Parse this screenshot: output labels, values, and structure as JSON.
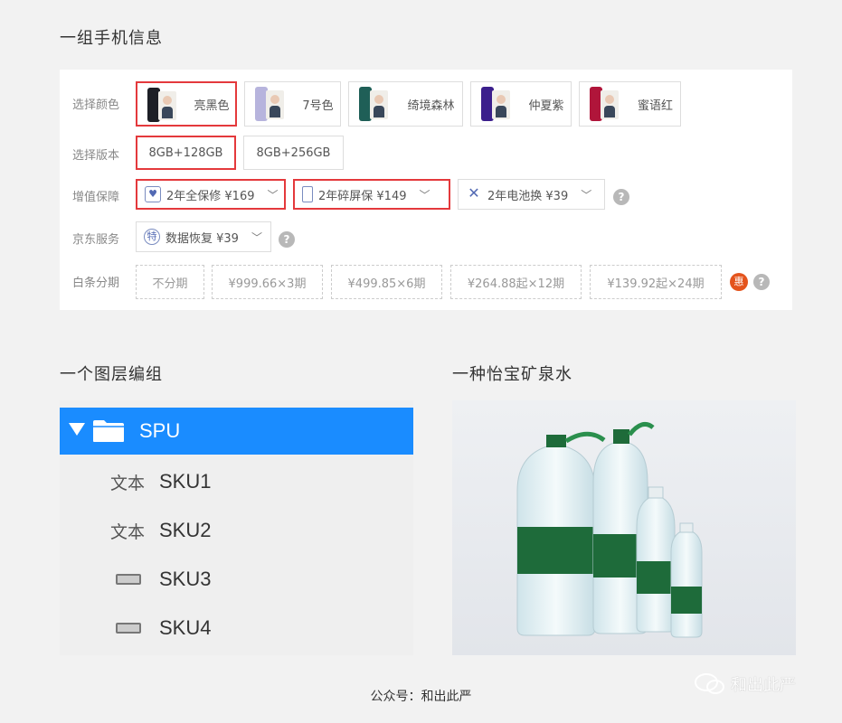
{
  "sections": {
    "phone_title": "一组手机信息",
    "layer_title": "一个图层编组",
    "water_title": "一种怡宝矿泉水"
  },
  "product": {
    "labels": {
      "color": "选择颜色",
      "version": "选择版本",
      "value_added": "增值保障",
      "jd_service": "京东服务",
      "installment": "白条分期"
    },
    "colors": [
      {
        "label": "亮黑色",
        "selected": true,
        "swatch": "#1d1f26"
      },
      {
        "label": "7号色",
        "selected": false,
        "swatch": "#b7b4dd"
      },
      {
        "label": "绮境森林",
        "selected": false,
        "swatch": "#1f5f57"
      },
      {
        "label": "仲夏紫",
        "selected": false,
        "swatch": "#3b1f8c"
      },
      {
        "label": "蜜语红",
        "selected": false,
        "swatch": "#b0153a"
      }
    ],
    "versions": [
      {
        "label": "8GB+128GB",
        "selected": true
      },
      {
        "label": "8GB+256GB",
        "selected": false
      }
    ],
    "services": [
      {
        "label": "2年全保修 ¥169",
        "icon": "shield-heart-icon",
        "selected": true
      },
      {
        "label": "2年碎屏保 ¥149",
        "icon": "phone-screen-icon",
        "selected": true
      },
      {
        "label": "2年电池换 ¥39",
        "icon": "tools-icon",
        "selected": false
      }
    ],
    "jd_service": {
      "label": "数据恢复 ¥39",
      "icon_char": "特"
    },
    "installments": [
      "不分期",
      "¥999.66×3期",
      "¥499.85×6期",
      "¥264.88起×12期",
      "¥139.92起×24期"
    ],
    "hui_badge": "惠",
    "help_glyph": "?",
    "chevron_glyph": "﹀"
  },
  "layers": {
    "group": {
      "label": "SPU",
      "selected": true
    },
    "items": [
      {
        "label": "SKU1",
        "icon": "text",
        "icon_text": "文本"
      },
      {
        "label": "SKU2",
        "icon": "text",
        "icon_text": "文本"
      },
      {
        "label": "SKU3",
        "icon": "rectangle"
      },
      {
        "label": "SKU4",
        "icon": "rectangle"
      }
    ]
  },
  "footer": "公众号：和出此严",
  "watermark": "和出此严",
  "colors": {
    "accent_red": "#e4393c",
    "selection_blue": "#1a8cff",
    "bottle_green": "#1e6b3a"
  }
}
